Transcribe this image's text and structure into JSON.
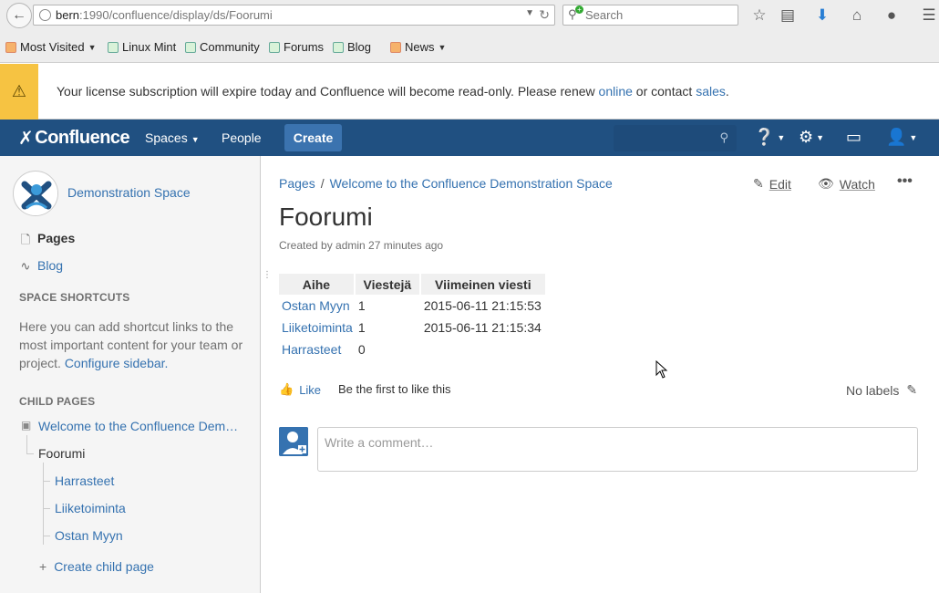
{
  "browser": {
    "url_host": "bern",
    "url_path": ":1990/confluence/display/ds/Foorumi",
    "search_placeholder": "Search",
    "bookmarks": [
      {
        "label": "Most Visited",
        "has_menu": true
      },
      {
        "label": "Linux Mint",
        "has_menu": false
      },
      {
        "label": "Community",
        "has_menu": false
      },
      {
        "label": "Forums",
        "has_menu": false
      },
      {
        "label": "Blog",
        "has_menu": false
      },
      {
        "label": "News",
        "has_menu": true
      }
    ]
  },
  "banner": {
    "text_before": "Your license subscription will expire today and Confluence will become read-only. Please renew ",
    "link_online": "online",
    "text_middle": " or contact ",
    "link_sales": "sales",
    "text_after": ".",
    "color": "#f6c342"
  },
  "header": {
    "logo": "Confluence",
    "spaces": "Spaces",
    "people": "People",
    "create": "Create",
    "bg_color": "#205081"
  },
  "sidebar": {
    "space_name": "Demonstration Space",
    "pages": "Pages",
    "blog": "Blog",
    "shortcuts_heading": "SPACE SHORTCUTS",
    "shortcuts_text": "Here you can add shortcut links to the most important content for your team or project.",
    "configure_link": "Configure sidebar.",
    "child_pages_heading": "CHILD PAGES",
    "tree_root": "Welcome to the Confluence Dem…",
    "tree_current": "Foorumi",
    "tree_children": [
      "Harrasteet",
      "Liiketoiminta",
      "Ostan Myyn"
    ],
    "create_child": "Create child page"
  },
  "main": {
    "breadcrumb": [
      "Pages",
      "Welcome to the Confluence Demonstration Space"
    ],
    "breadcrumb_sep": "/",
    "edit": "Edit",
    "watch": "Watch",
    "title": "Foorumi",
    "byline": "Created by admin 27 minutes ago",
    "table": {
      "headers": [
        "Aihe",
        "Viestejä",
        "Viimeinen viesti"
      ],
      "rows": [
        {
          "topic": "Ostan Myyn",
          "count": "1",
          "last": "2015-06-11 21:15:53"
        },
        {
          "topic": "Liiketoiminta",
          "count": "1",
          "last": "2015-06-11 21:15:34"
        },
        {
          "topic": "Harrasteet",
          "count": "0",
          "last": ""
        }
      ]
    },
    "like": "Like",
    "like_first": "Be the first to like this",
    "labels": "No labels",
    "comment_placeholder": "Write a comment…"
  }
}
